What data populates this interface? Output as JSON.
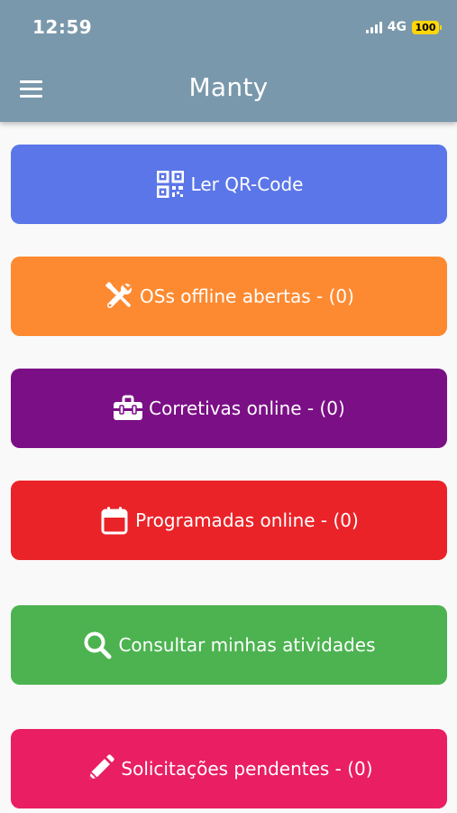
{
  "status_bar": {
    "time": "12:59",
    "network": "4G",
    "battery": "100"
  },
  "header": {
    "title": "Manty",
    "menu_icon": "hamburger-menu-icon"
  },
  "actions": [
    {
      "label": "Ler QR-Code",
      "icon": "qr-code-icon",
      "color": "#5b76e8"
    },
    {
      "label": "OSs offline abertas - (0)",
      "icon": "tools-icon",
      "color": "#fd8a31"
    },
    {
      "label": "Corretivas online - (0)",
      "icon": "toolbox-icon",
      "color": "#7b0f86"
    },
    {
      "label": "Programadas online - (0)",
      "icon": "calendar-icon",
      "color": "#ea2328"
    },
    {
      "label": "Consultar minhas atividades",
      "icon": "search-icon",
      "color": "#4cb350"
    },
    {
      "label": "Solicitações pendentes - (0)",
      "icon": "pencil-icon",
      "color": "#e91e63"
    }
  ],
  "colors": {
    "header": "#7a98ab",
    "background": "#f9f9f9",
    "battery": "#ffd60a"
  }
}
